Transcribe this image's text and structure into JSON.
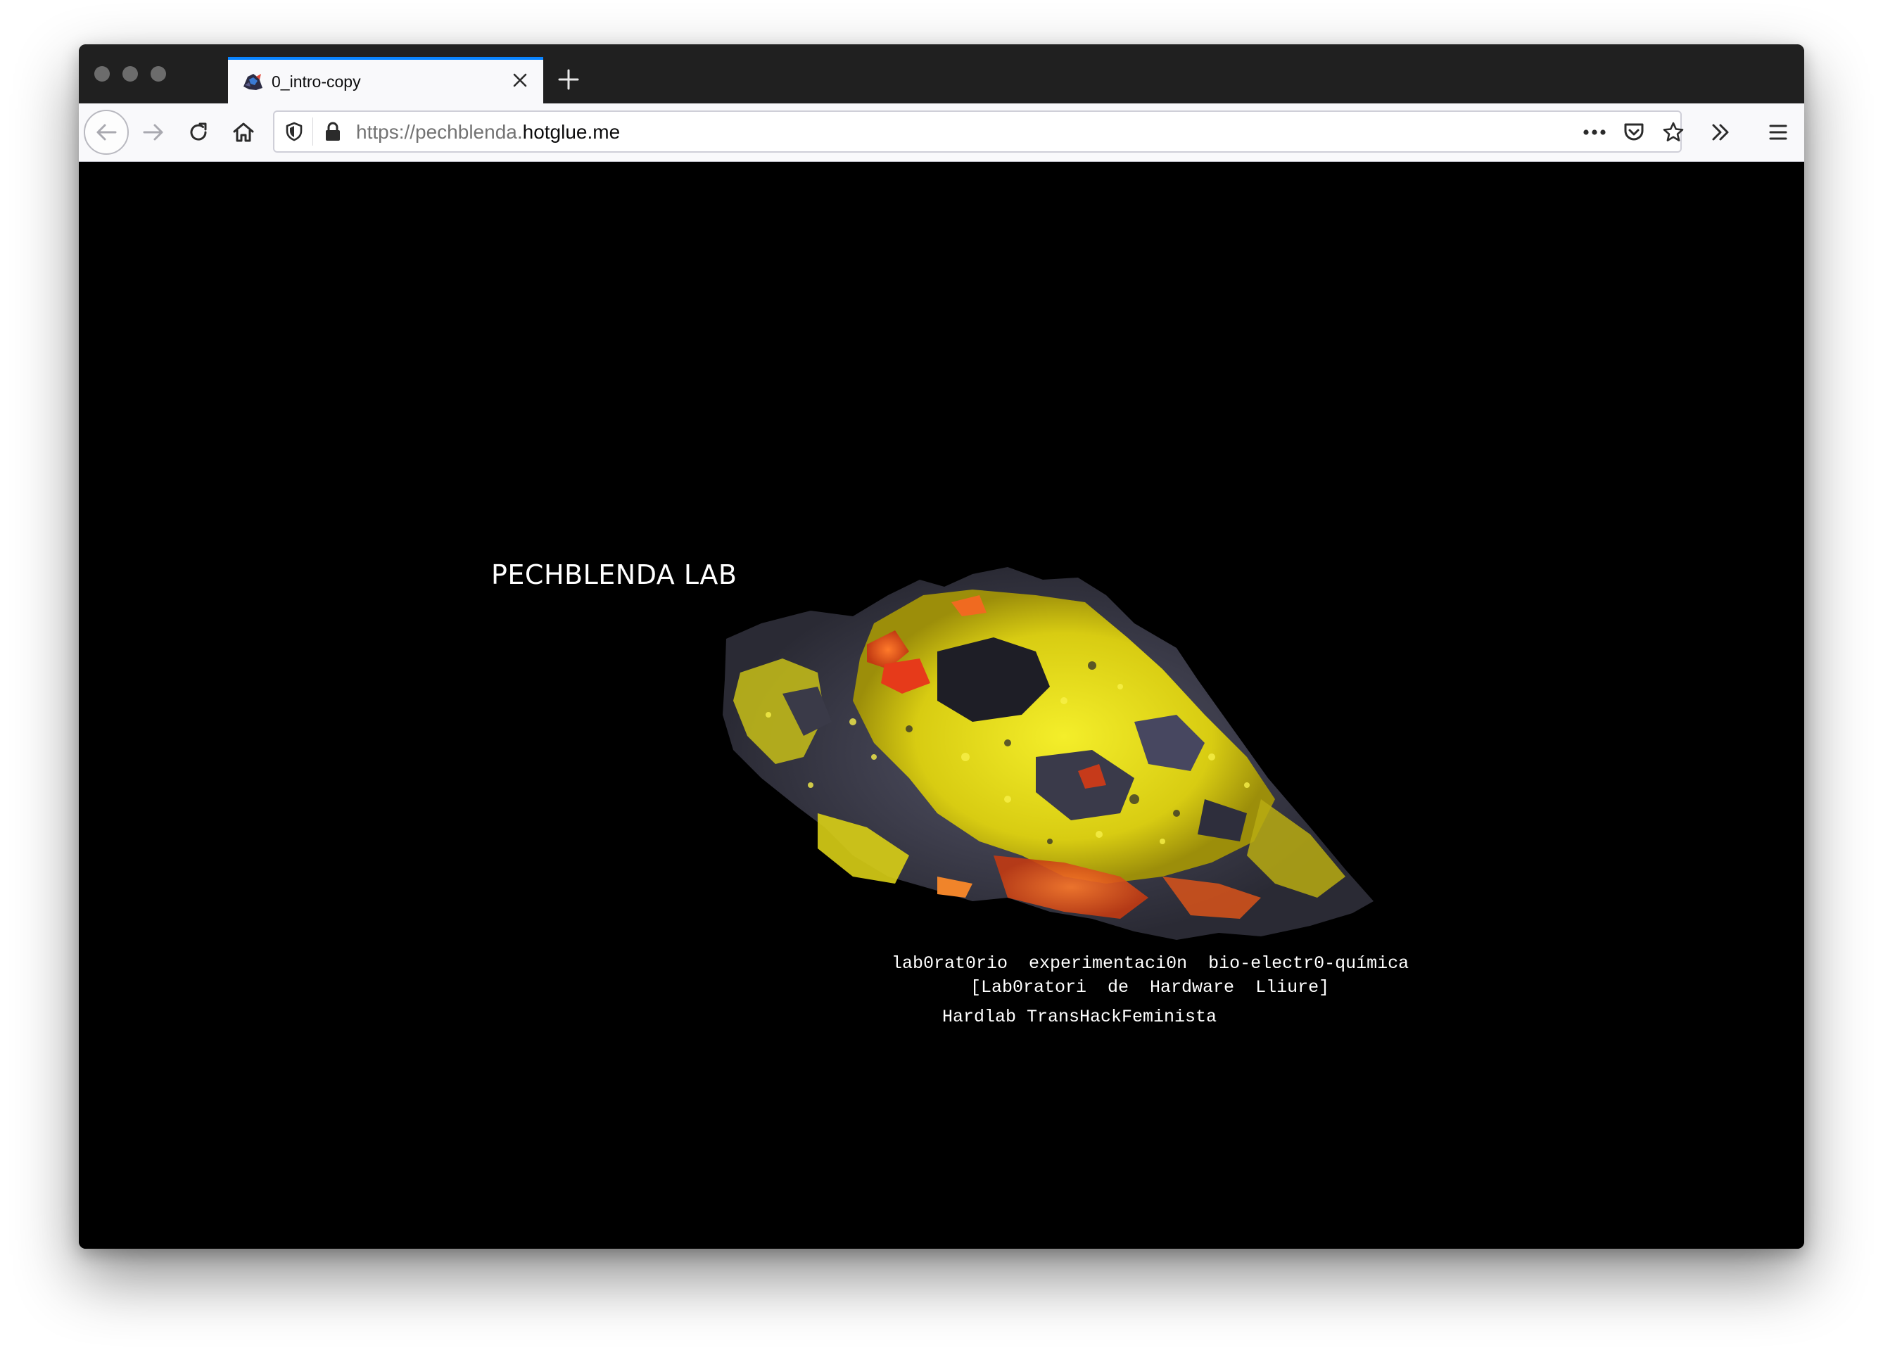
{
  "browser": {
    "tab": {
      "title": "0_intro-copy",
      "favicon": "mineral-favicon-icon",
      "close_icon": "close-icon"
    },
    "new_tab_icon": "plus-icon",
    "toolbar": {
      "back_icon": "arrow-left-icon",
      "forward_icon": "arrow-right-icon",
      "reload_icon": "reload-icon",
      "home_icon": "home-icon",
      "overflow_icon": "double-chevron-right-icon",
      "menu_icon": "hamburger-menu-icon"
    },
    "urlbar": {
      "url_prefix": "https://pechblenda.",
      "url_host": "hotglue.me",
      "shield_icon": "tracking-shield-icon",
      "lock_icon": "lock-icon",
      "page_actions_icon": "more-dots-icon",
      "pocket_icon": "pocket-icon",
      "bookmark_icon": "star-icon"
    },
    "colors": {
      "chrome_dark": "#202020",
      "toolbar_bg": "#f9f9fb",
      "tab_accent": "#0a84ff",
      "page_bg": "#000000"
    }
  },
  "page": {
    "title": "PECHBLENDA LAB",
    "image": "uranium-mineral-rock",
    "tagline_line1": "lab0rat0rio  experimentaci0n  bio-electr0-química",
    "tagline_line2": "[Lab0ratori  de  Hardware  Lliure]",
    "tagline_line3": "Hardlab TransHackFeminista",
    "colors": {
      "text": "#ffffff",
      "mineral_yellow": "#e8e01a",
      "mineral_orange": "#e0561a",
      "mineral_dark": "#3a3a48"
    }
  }
}
